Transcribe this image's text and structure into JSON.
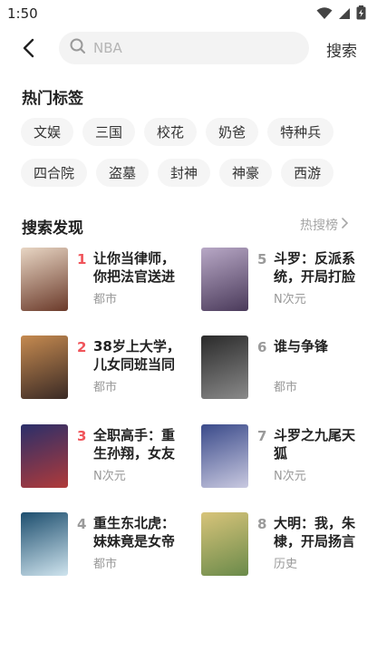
{
  "status_bar": {
    "time": "1:50"
  },
  "search": {
    "placeholder": "NBA",
    "button_label": "搜索"
  },
  "hot_tags": {
    "title": "热门标签",
    "rows": [
      [
        "文娱",
        "三国",
        "校花",
        "奶爸",
        "特种兵"
      ],
      [
        "四合院",
        "盗墓",
        "封神",
        "神豪",
        "西游"
      ]
    ]
  },
  "discover": {
    "title": "搜索发现",
    "hot_list_label": "热搜榜",
    "books": [
      {
        "rank": "1",
        "title": "让你当律师，你把法官送进",
        "category": "都市",
        "cover_colors": [
          "#e8d6c4",
          "#6b3a2a"
        ]
      },
      {
        "rank": "2",
        "title": "38岁上大学，儿女同班当同",
        "category": "都市",
        "cover_colors": [
          "#c58a50",
          "#3a2a25"
        ]
      },
      {
        "rank": "3",
        "title": "全职高手：重生孙翔，女友",
        "category": "N次元",
        "cover_colors": [
          "#2a2f6a",
          "#b03a3a"
        ]
      },
      {
        "rank": "4",
        "title": "重生东北虎：妹妹竟是女帝",
        "category": "都市",
        "cover_colors": [
          "#1d4e6e",
          "#cfe4ee"
        ]
      },
      {
        "rank": "5",
        "title": "斗罗：反派系统，开局打脸",
        "category": "N次元",
        "cover_colors": [
          "#b8a8c6",
          "#4a3a5a"
        ]
      },
      {
        "rank": "6",
        "title": "谁与争锋",
        "category": "都市",
        "cover_colors": [
          "#2a2a2a",
          "#8a8a8a"
        ]
      },
      {
        "rank": "7",
        "title": "斗罗之九尾天狐",
        "category": "N次元",
        "cover_colors": [
          "#3a4a8a",
          "#c9c9e0"
        ]
      },
      {
        "rank": "8",
        "title": "大明：我，朱棣，开局扬言",
        "category": "历史",
        "cover_colors": [
          "#d8c47a",
          "#6a8a4a"
        ]
      }
    ]
  }
}
